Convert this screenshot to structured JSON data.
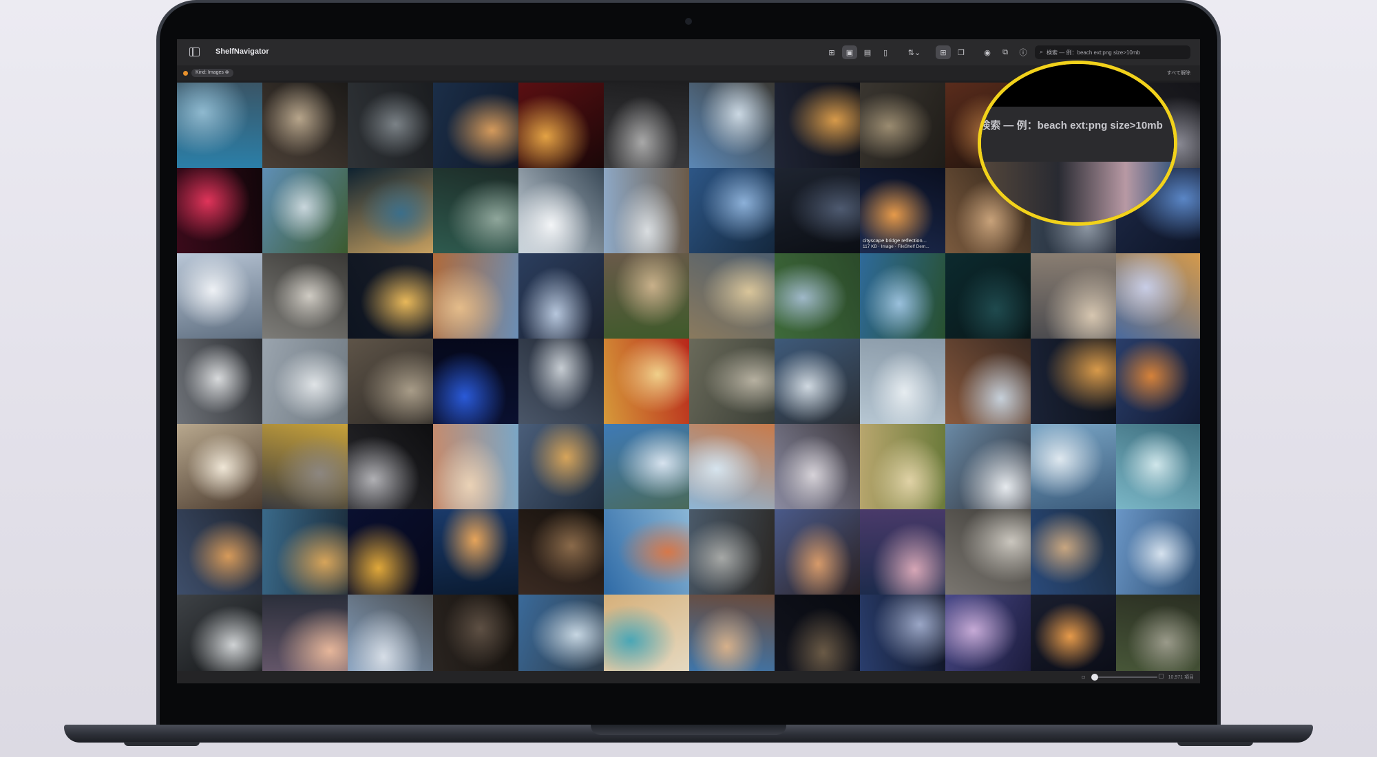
{
  "app": {
    "title": "ShelfNavigator",
    "sidebar_toggle_icon": "sidebar-icon"
  },
  "toolbar": {
    "buttons": [
      {
        "icon": "grid-small-icon",
        "glyph": "⊞",
        "active": false
      },
      {
        "icon": "photo-icon",
        "glyph": "▣",
        "active": true
      },
      {
        "icon": "filmstrip-icon",
        "glyph": "▤",
        "active": false
      },
      {
        "icon": "document-icon",
        "glyph": "▯",
        "active": false
      },
      {
        "icon": "sort-icon",
        "glyph": "⇅⌄",
        "active": false
      },
      {
        "icon": "grid-large-icon",
        "glyph": "⊞",
        "active": true
      },
      {
        "icon": "windows-icon",
        "glyph": "❐",
        "active": false
      },
      {
        "icon": "preview-icon",
        "glyph": "◉",
        "active": false
      },
      {
        "icon": "copy-icon",
        "glyph": "⧉",
        "active": false
      },
      {
        "icon": "info-icon",
        "glyph": "ⓘ",
        "active": false
      }
    ],
    "search_placeholder": "検索 — 例：beach ext:png size>10mb"
  },
  "filter": {
    "chip_label": "Kind: Images ⊗",
    "clear_all": "すべて解除",
    "dot_color": "#e8912c"
  },
  "grid": {
    "columns": 12,
    "tiles": [
      [
        "#2b7fa8",
        "#8fb9cf",
        "#3a5566"
      ],
      [
        "#4a3f36",
        "#b7a58b",
        "#1c1a18"
      ],
      [
        "#2f3337",
        "#7b8287",
        "#1b1d20"
      ],
      [
        "#1b2e48",
        "#d49a5c",
        "#0f1828"
      ],
      [
        "#5a0f12",
        "#e3a244",
        "#1a0708"
      ],
      [
        "#3c3c3e",
        "#a8a8a8",
        "#1e1e20"
      ],
      [
        "#5b87b5",
        "#cbd8e3",
        "#3b3a36"
      ],
      [
        "#1f2434",
        "#d79a4a",
        "#0e1018"
      ],
      [
        "#3a3630",
        "#9a8b70",
        "#1f1c18"
      ],
      [
        "#5a2c1c",
        "#a46a3a",
        "#1e120c"
      ],
      [
        "#6b5040",
        "#b9977a",
        "#2a2620"
      ],
      [
        "#24242a",
        "#8a8a94",
        "#141418"
      ],
      [
        "#3a0a1a",
        "#e0345a",
        "#12060a"
      ],
      [
        "#5f8fb6",
        "#c9d6dc",
        "#3b5a2e"
      ],
      [
        "#0e2230",
        "#3b6e8a",
        "#c7a060"
      ],
      [
        "#2e5a4e",
        "#8fa69b",
        "#1c2a26"
      ],
      [
        "#c9d3db",
        "#f3f5f7",
        "#3a4a58"
      ],
      [
        "#8ea9c7",
        "#d9dde0",
        "#6b5a48"
      ],
      [
        "#2d5686",
        "#8cb0d8",
        "#14283e"
      ],
      [
        "#1e2430",
        "#4e5a70",
        "#0b0e14"
      ],
      [
        "#1c2a4e",
        "#e69a4a",
        "#0a0f20"
      ],
      [
        "#7a5a3e",
        "#c8a27a",
        "#2e2218"
      ],
      [
        "#354250",
        "#8c96a2",
        "#1c2230"
      ],
      [
        "#1e2a48",
        "#5a86c6",
        "#0d1426"
      ],
      [
        "#b9c6d6",
        "#eef1f5",
        "#5e6e80"
      ],
      [
        "#7d7c78",
        "#cfcbc3",
        "#3a3936"
      ],
      [
        "#0d1420",
        "#e8b85a",
        "#1a1e28"
      ],
      [
        "#b06a3a",
        "#e4bc8a",
        "#6a8eb6"
      ],
      [
        "#2b3e5e",
        "#b6c6dc",
        "#1a2030"
      ],
      [
        "#6a5a4a",
        "#c8b08a",
        "#3e5a2a"
      ],
      [
        "#8a7a5e",
        "#d9c59a",
        "#4e5e6e"
      ],
      [
        "#3e6a3a",
        "#9fb8c8",
        "#2b4a2a"
      ],
      [
        "#2e6a9a",
        "#9ac0dc",
        "#28502e"
      ],
      [
        "#0c2a2e",
        "#1f4a4e",
        "#081618"
      ],
      [
        "#8a7e72",
        "#d6c6b0",
        "#4a4a4e"
      ],
      [
        "#4a6a9e",
        "#c8cde6",
        "#d69a4a"
      ],
      [
        "#6e7278",
        "#d8dadc",
        "#2a2c30"
      ],
      [
        "#9aa4ae",
        "#dfe3e6",
        "#6e7880"
      ],
      [
        "#5e5448",
        "#a89c88",
        "#2e2a26"
      ],
      [
        "#0a1030",
        "#2a5ad8",
        "#05081a"
      ],
      [
        "#4a5668",
        "#c6ccd2",
        "#1e2430"
      ],
      [
        "#d69a3a",
        "#f0d08a",
        "#b8261a"
      ],
      [
        "#6a6a5a",
        "#b6b0a0",
        "#3a3e36"
      ],
      [
        "#3e5a7a",
        "#cfd8e0",
        "#2a2e34"
      ],
      [
        "#b6c6d2",
        "#e6ecf0",
        "#8a9aa8"
      ],
      [
        "#8a5a3e",
        "#c6d0da",
        "#3a2a22"
      ],
      [
        "#1a2236",
        "#d89a4a",
        "#0c1018"
      ],
      [
        "#2a3e6a",
        "#d6823a",
        "#101830"
      ],
      [
        "#b8a88e",
        "#efe6d6",
        "#4a3a2e"
      ],
      [
        "#3a3a3e",
        "#8c8680",
        "#c8a23a"
      ],
      [
        "#2a2a2e",
        "#b0b0b4",
        "#0e0e10"
      ],
      [
        "#c88a6a",
        "#ead2b6",
        "#7aa6c6"
      ],
      [
        "#4a5e7a",
        "#d6a45a",
        "#1e2a3a"
      ],
      [
        "#3e7ab6",
        "#d6e2ee",
        "#4a6a5a"
      ],
      [
        "#8eb6d6",
        "#d6e4ee",
        "#c87a4a"
      ],
      [
        "#8a8aa0",
        "#d6d2d8",
        "#3e3a40"
      ],
      [
        "#b8a66e",
        "#e0d2a6",
        "#6a7a3a"
      ],
      [
        "#6a8aa6",
        "#e6eaee",
        "#2a2a30"
      ],
      [
        "#7aa6c6",
        "#dfe8ef",
        "#3a5a7a"
      ],
      [
        "#7ab6c6",
        "#cfe6ea",
        "#3a6a7a"
      ],
      [
        "#3e4e6a",
        "#d69a5a",
        "#1e2430"
      ],
      [
        "#3a6a8a",
        "#d6a45a",
        "#1a2a38"
      ],
      [
        "#0a1030",
        "#e0a83a",
        "#06081a"
      ],
      [
        "#1a3a6a",
        "#e6a45a",
        "#0a1a30"
      ],
      [
        "#3a2a22",
        "#8a6a4a",
        "#14100c"
      ],
      [
        "#2e6aa6",
        "#d6784a",
        "#8ab6d6"
      ],
      [
        "#4a5a6a",
        "#a6a8a6",
        "#2a2622"
      ],
      [
        "#4a5a8a",
        "#d69a6a",
        "#2a2020"
      ],
      [
        "#4a3a6a",
        "#d6a6b6",
        "#1a2a4a"
      ],
      [
        "#7a7670",
        "#cac6be",
        "#3e3c38"
      ],
      [
        "#2a4a7a",
        "#c8a680",
        "#1a2a3e"
      ],
      [
        "#6a96c6",
        "#d6e2ee",
        "#2a4a6e"
      ],
      [
        "#3e4246",
        "#cfd2d4",
        "#101214"
      ],
      [
        "#6a5a6e",
        "#e6b69a",
        "#2a2e3a"
      ],
      [
        "#8aa6c6",
        "#d6dde6",
        "#4a4e52"
      ],
      [
        "#2a2420",
        "#5e5044",
        "#14100c"
      ],
      [
        "#3a6a9a",
        "#c6d6e2",
        "#2e3a46"
      ],
      [
        "#d6b07a",
        "#4aa6b6",
        "#e6dcc6"
      ],
      [
        "#3a7ab6",
        "#d6b08a",
        "#6a4a3a"
      ],
      [
        "#12141e",
        "#6a5a46",
        "#080a10"
      ],
      [
        "#2a3e6e",
        "#9aa6c6",
        "#0e1220"
      ],
      [
        "#4a4a8a",
        "#c6aad6",
        "#1a1a3a"
      ],
      [
        "#1a1e2e",
        "#e69a4a",
        "#0a0c16"
      ],
      [
        "#4a5a3a",
        "#9a9a8a",
        "#2a2e22"
      ]
    ],
    "caption": {
      "title": "cityscape bridge reflection...",
      "meta": "117 KB · Image · FileShelf Dem..."
    }
  },
  "status": {
    "zoom_small_icon": "small-tiles-icon",
    "zoom_large_icon": "large-tiles-icon",
    "zoom_level": 0.05,
    "item_count": "10,971 項目"
  },
  "callout": {
    "text": "検索 — 例：beach ext:png size>10mb",
    "ring_color": "#f2d21b"
  }
}
